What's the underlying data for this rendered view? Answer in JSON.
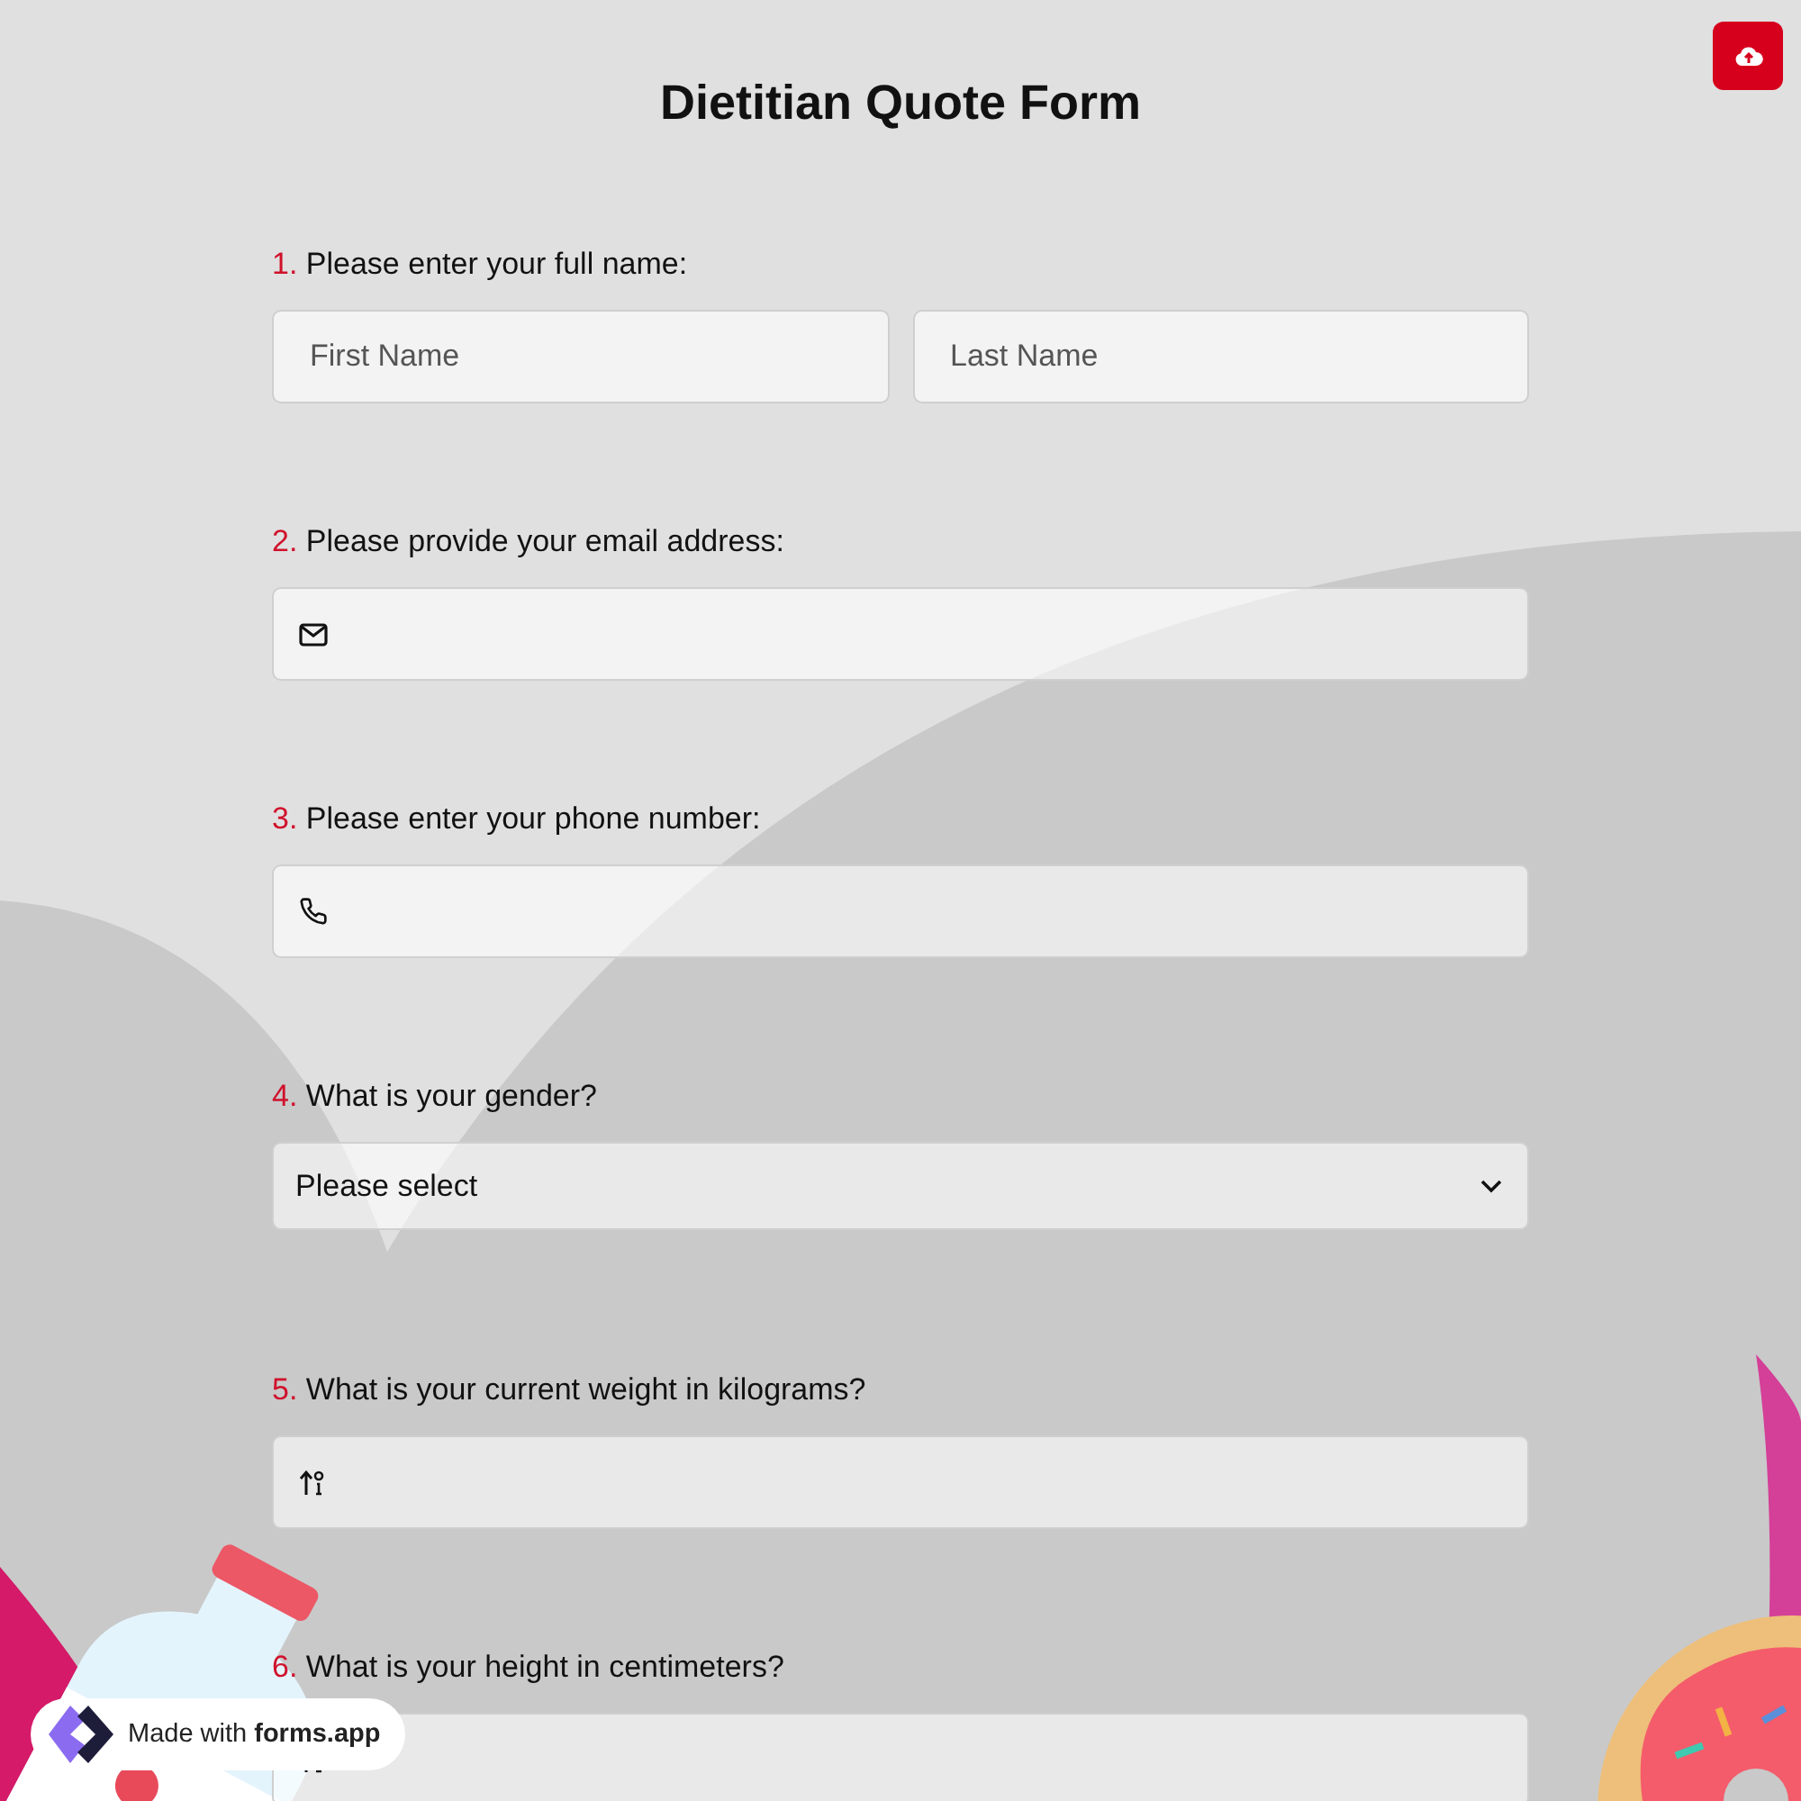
{
  "title": "Dietitian Quote Form",
  "questions": [
    {
      "number": "1.",
      "label": "Please enter your full name:",
      "kind": "name",
      "fields": [
        {
          "placeholder": "First Name"
        },
        {
          "placeholder": "Last Name"
        }
      ]
    },
    {
      "number": "2.",
      "label": "Please provide your email address:",
      "kind": "email"
    },
    {
      "number": "3.",
      "label": "Please enter your phone number:",
      "kind": "phone"
    },
    {
      "number": "4.",
      "label": "What is your gender?",
      "kind": "select",
      "value": "Please select"
    },
    {
      "number": "5.",
      "label": "What is your current weight in kilograms?",
      "kind": "number"
    },
    {
      "number": "6.",
      "label": "What is your height in centimeters?",
      "kind": "number"
    }
  ],
  "badge": {
    "text": "Made with **forms.app**"
  }
}
